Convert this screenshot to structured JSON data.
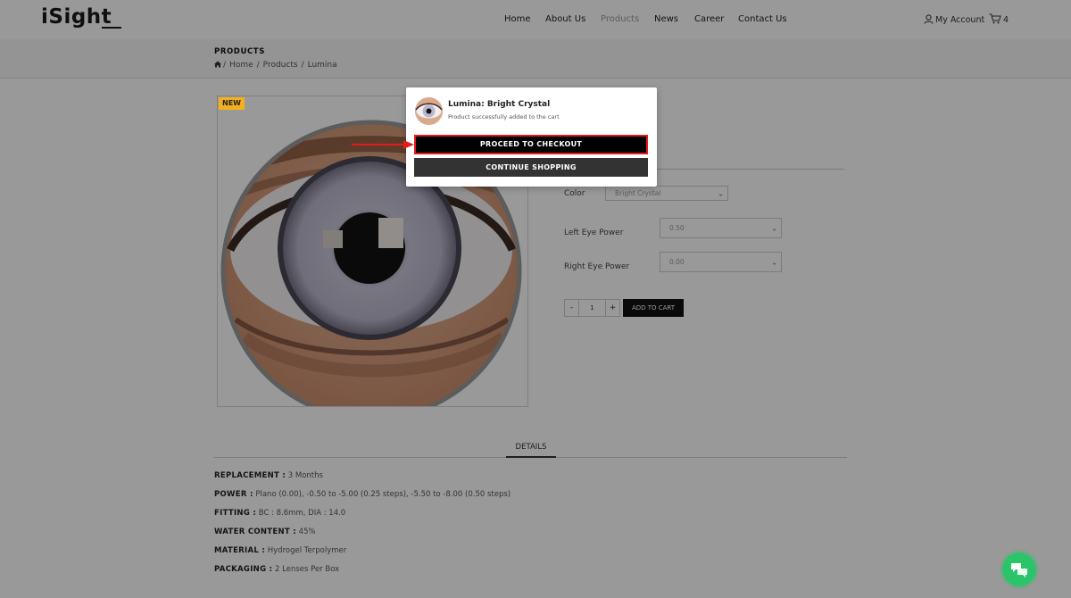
{
  "brand": {
    "logo_text": "iSight"
  },
  "nav": [
    {
      "label": "Home"
    },
    {
      "label": "About Us"
    },
    {
      "label": "Products",
      "active": true
    },
    {
      "label": "News"
    },
    {
      "label": "Career"
    },
    {
      "label": "Contact Us"
    }
  ],
  "account": {
    "label": "My Account",
    "icon": "user-icon"
  },
  "cart": {
    "count": "4",
    "icon": "cart-icon"
  },
  "page": {
    "title": "PRODUCTS",
    "breadcrumb": [
      "Home",
      "Products",
      "Lumina"
    ],
    "home_icon": "home-icon"
  },
  "product": {
    "badge": "NEW",
    "color_label": "Color",
    "color_value": "Bright Crystal",
    "left_power_label": "Left Eye Power",
    "left_power_value": "0.50",
    "right_power_label": "Right Eye Power",
    "right_power_value": "0.00",
    "qty_minus": "-",
    "qty_value": "1",
    "qty_plus": "+",
    "add_to_cart": "ADD TO CART"
  },
  "details": {
    "tab_label": "DETAILS",
    "specs": [
      {
        "key": "REPLACEMENT :",
        "value": " 3 Months"
      },
      {
        "key": "POWER :",
        "value": " Plano (0.00), -0.50 to -5.00 (0.25 steps), -5.50 to -8.00 (0.50 steps)"
      },
      {
        "key": "FITTING :",
        "value": " BC : 8.6mm, DIA : 14.0"
      },
      {
        "key": "WATER CONTENT :",
        "value": " 45%"
      },
      {
        "key": "MATERIAL :",
        "value": " Hydrogel Terpolymer"
      },
      {
        "key": "PACKAGING :",
        "value": " 2 Lenses Per Box"
      }
    ]
  },
  "modal": {
    "product_name": "Lumina: Bright Crystal",
    "message": "Product successfully added to the cart",
    "checkout_label": "PROCEED TO CHECKOUT",
    "continue_label": "CONTINUE SHOPPING"
  },
  "chat": {
    "icon": "chat-icon"
  },
  "colors": {
    "accent_badge": "#f2b01e",
    "highlight_red": "#e31b1b",
    "chat_green": "#2bc46a"
  }
}
